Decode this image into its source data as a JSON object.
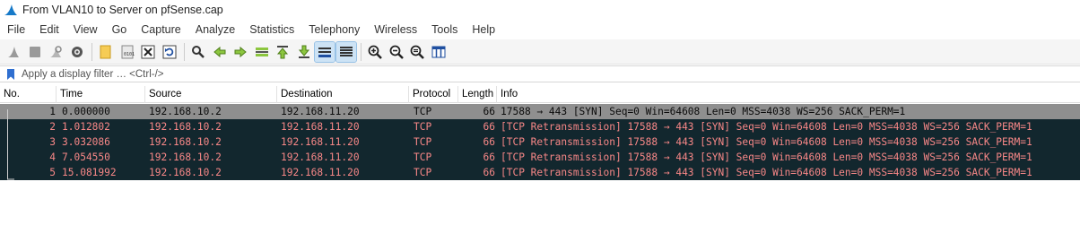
{
  "window": {
    "title": "From VLAN10 to Server on pfSense.cap",
    "icon": "wireshark-fin-icon"
  },
  "menu": [
    "File",
    "Edit",
    "View",
    "Go",
    "Capture",
    "Analyze",
    "Statistics",
    "Telephony",
    "Wireless",
    "Tools",
    "Help"
  ],
  "toolbar": [
    "start-capture-icon",
    "stop-capture-icon",
    "restart-capture-icon",
    "capture-options-icon",
    "open-file-icon",
    "save-file-icon",
    "close-file-icon",
    "reload-file-icon",
    "find-packet-icon",
    "go-back-icon",
    "go-forward-icon",
    "go-to-packet-icon",
    "first-packet-icon",
    "last-packet-icon",
    "autoscroll-icon",
    "colorize-icon",
    "zoom-in-icon",
    "zoom-out-icon",
    "normal-size-icon",
    "resize-columns-icon"
  ],
  "filter": {
    "placeholder": "Apply a display filter … <Ctrl-/>",
    "value": ""
  },
  "columns": {
    "no": "No.",
    "time": "Time",
    "source": "Source",
    "destination": "Destination",
    "protocol": "Protocol",
    "length": "Length",
    "info": "Info"
  },
  "packets": [
    {
      "no": "1",
      "time": "0.000000",
      "source": "192.168.10.2",
      "destination": "192.168.11.20",
      "protocol": "TCP",
      "length": "66",
      "info": "17588 → 443 [SYN] Seq=0 Win=64608 Len=0 MSS=4038 WS=256 SACK_PERM=1",
      "style": "selected"
    },
    {
      "no": "2",
      "time": "1.012802",
      "source": "192.168.10.2",
      "destination": "192.168.11.20",
      "protocol": "TCP",
      "length": "66",
      "info": "[TCP Retransmission] 17588 → 443 [SYN] Seq=0 Win=64608 Len=0 MSS=4038 WS=256 SACK_PERM=1",
      "style": "retrans"
    },
    {
      "no": "3",
      "time": "3.032086",
      "source": "192.168.10.2",
      "destination": "192.168.11.20",
      "protocol": "TCP",
      "length": "66",
      "info": "[TCP Retransmission] 17588 → 443 [SYN] Seq=0 Win=64608 Len=0 MSS=4038 WS=256 SACK_PERM=1",
      "style": "retrans"
    },
    {
      "no": "4",
      "time": "7.054550",
      "source": "192.168.10.2",
      "destination": "192.168.11.20",
      "protocol": "TCP",
      "length": "66",
      "info": "[TCP Retransmission] 17588 → 443 [SYN] Seq=0 Win=64608 Len=0 MSS=4038 WS=256 SACK_PERM=1",
      "style": "retrans"
    },
    {
      "no": "5",
      "time": "15.081992",
      "source": "192.168.10.2",
      "destination": "192.168.11.20",
      "protocol": "TCP",
      "length": "66",
      "info": "[TCP Retransmission] 17588 → 443 [SYN] Seq=0 Win=64608 Len=0 MSS=4038 WS=256 SACK_PERM=1",
      "style": "retrans"
    }
  ],
  "colors": {
    "selected_row": "#8f8f8f",
    "retransmission_bg": "#12272e",
    "retransmission_fg": "#f78787",
    "toolbar_bg": "#f5f5f5"
  }
}
